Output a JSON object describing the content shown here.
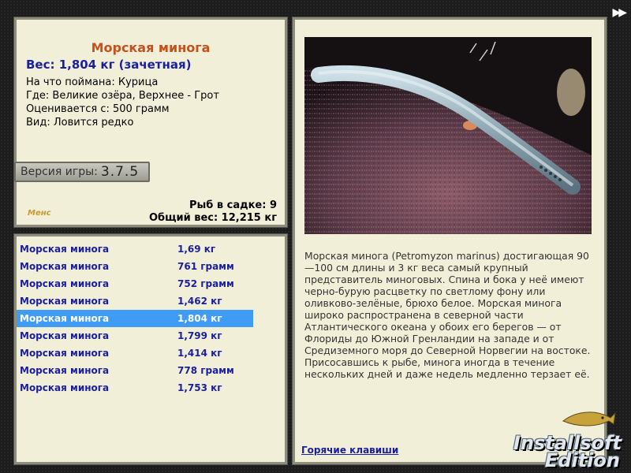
{
  "info": {
    "fish_name": "Морская минога",
    "weight": "Вес: 1,804 кг (зачетная)",
    "lines": [
      "На что поймана: Курица",
      "Где: Великие озёра, Верхнее - Грот",
      "Оценивается с: 500 грамм",
      "Вид: Ловится редко"
    ],
    "version_label": "Версия игры:",
    "version_number": "3.7.5",
    "small_logo": "Менс",
    "cage_count": "Рыб в садке: 9",
    "total_weight": "Общий вес: 12,215 кг"
  },
  "catch_list": [
    {
      "name": "Морская минога",
      "weight": "1,69 кг",
      "selected": false
    },
    {
      "name": "Морская минога",
      "weight": "761 грамм",
      "selected": false
    },
    {
      "name": "Морская минога",
      "weight": "752 грамм",
      "selected": false
    },
    {
      "name": "Морская минога",
      "weight": "1,462 кг",
      "selected": false
    },
    {
      "name": "Морская минога",
      "weight": "1,804 кг",
      "selected": true
    },
    {
      "name": "Морская минога",
      "weight": "1,799 кг",
      "selected": false
    },
    {
      "name": "Морская минога",
      "weight": "1,414 кг",
      "selected": false
    },
    {
      "name": "Морская минога",
      "weight": "778 грамм",
      "selected": false
    },
    {
      "name": "Морская минога",
      "weight": "1,753 кг",
      "selected": false
    }
  ],
  "description": {
    "text": "Морская минога (Petromyzon marinus) достигающая 90—100 см длины и 3 кг веса самый крупный представитель миноговых. Спина и бока у неё имеют черно-бурую расцветку по светлому фону или оливково-зелёные, брюхо белое. Морская минога широко распространена в северной части Атлантического океана у обоих его берегов — от Флориды до Южной Гренландии на западе и от Средиземного моря до Северной Норвегии на востоке. Присосавшись к рыбе, минога иногда в течение нескольких дней и даже недель медленно терзает её.",
    "hotkeys_link": "Горячие клавиши"
  },
  "controls": {
    "fast_forward": "▶▶"
  },
  "brand": {
    "line1": "Installsoft",
    "line2": "Edition"
  },
  "icons": {
    "fast_forward": "fast-forward-icon",
    "fish_photo": "lamprey-photo"
  }
}
